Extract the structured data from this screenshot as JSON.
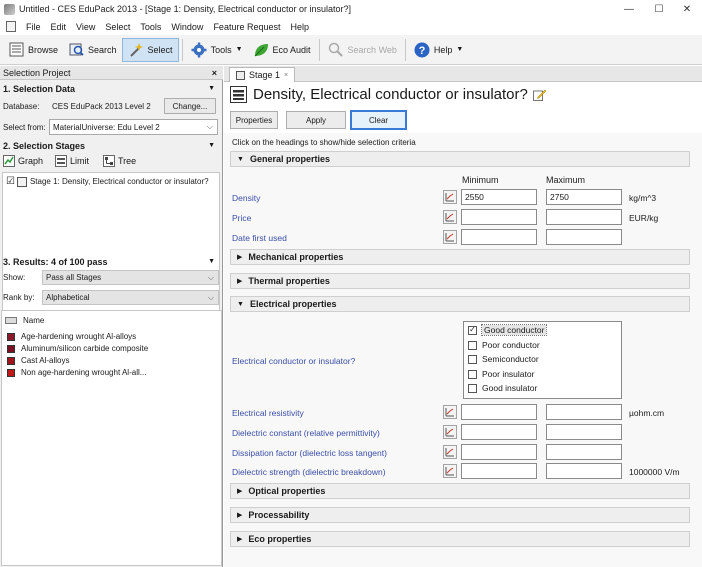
{
  "window": {
    "title": "Untitled - CES EduPack 2013 - [Stage 1: Density, Electrical conductor or insulator?]",
    "min_glyph": "—",
    "max_glyph": "☐",
    "close_glyph": "✕"
  },
  "menu": [
    "File",
    "Edit",
    "View",
    "Select",
    "Tools",
    "Window",
    "Feature Request",
    "Help"
  ],
  "toolbar": {
    "browse": "Browse",
    "search": "Search",
    "select": "Select",
    "tools": "Tools",
    "eco_audit": "Eco Audit",
    "search_web": "Search Web",
    "help": "Help",
    "caret": "▼"
  },
  "left_panel": {
    "header": "Selection Project",
    "close_glyph": "×",
    "selection_data": {
      "title": "1. Selection Data",
      "database_label": "Database:",
      "database_value": "CES EduPack 2013 Level 2",
      "change_button": "Change...",
      "select_from_label": "Select from:",
      "select_from_value": "MaterialUniverse: Edu Level 2"
    },
    "selection_stages": {
      "title": "2. Selection Stages",
      "graph": "Graph",
      "limit": "Limit",
      "tree": "Tree",
      "stage_item": "Stage 1: Density, Electrical conductor or insulator?",
      "stage_checked": "☑"
    },
    "results": {
      "title": "3. Results: 4 of 100 pass",
      "show_label": "Show:",
      "show_value": "Pass all Stages",
      "rank_label": "Rank by:",
      "rank_value": "Alphabetical",
      "name_header": "Name",
      "items": [
        {
          "name": "Age-hardening wrought Al-alloys",
          "color": "#8b1a2b"
        },
        {
          "name": "Aluminum/silicon carbide composite",
          "color": "#7a1020"
        },
        {
          "name": "Cast Al-alloys",
          "color": "#a0141c"
        },
        {
          "name": "Non age-hardening wrought Al-all...",
          "color": "#c01818"
        }
      ]
    },
    "caret": "▼",
    "dropdown_glyph": "⌵"
  },
  "stage": {
    "tab_label": "Stage 1",
    "tab_close": "×",
    "heading": "Density, Electrical conductor or insulator?",
    "buttons": {
      "properties": "Properties",
      "apply": "Apply",
      "clear": "Clear"
    },
    "instruction": "Click on the headings to show/hide selection criteria",
    "expanded_arrow": "▼",
    "collapsed_arrow": "▶",
    "columns": {
      "minimum": "Minimum",
      "maximum": "Maximum"
    },
    "general": {
      "title": "General properties",
      "rows": [
        {
          "label": "Density",
          "min": "2550",
          "max": "2750",
          "unit": "kg/m^3"
        },
        {
          "label": "Price",
          "min": "",
          "max": "",
          "unit": "EUR/kg"
        },
        {
          "label": "Date first used",
          "min": "",
          "max": "",
          "unit": ""
        }
      ]
    },
    "mechanical": {
      "title": "Mechanical properties"
    },
    "thermal": {
      "title": "Thermal properties"
    },
    "electrical": {
      "title": "Electrical properties",
      "conductor_label": "Electrical conductor or insulator?",
      "options": [
        {
          "label": "Good conductor",
          "checked": true,
          "mark": "✓"
        },
        {
          "label": "Poor conductor",
          "checked": false,
          "mark": ""
        },
        {
          "label": "Semiconductor",
          "checked": false,
          "mark": ""
        },
        {
          "label": "Poor insulator",
          "checked": false,
          "mark": ""
        },
        {
          "label": "Good insulator",
          "checked": false,
          "mark": ""
        }
      ],
      "rows": [
        {
          "label": "Electrical resistivity",
          "min": "",
          "max": "",
          "unit": "µohm.cm"
        },
        {
          "label": "Dielectric constant (relative permittivity)",
          "min": "",
          "max": "",
          "unit": ""
        },
        {
          "label": "Dissipation factor (dielectric loss tangent)",
          "min": "",
          "max": "",
          "unit": ""
        },
        {
          "label": "Dielectric strength (dielectric breakdown)",
          "min": "",
          "max": "",
          "unit": "1000000 V/m"
        }
      ]
    },
    "optical": {
      "title": "Optical properties"
    },
    "processability": {
      "title": "Processability"
    },
    "eco": {
      "title": "Eco properties"
    }
  },
  "colors": {
    "accent": "#3a7ad6",
    "label_blue": "#3a4ea7",
    "select_active": "#cfe3f5"
  }
}
